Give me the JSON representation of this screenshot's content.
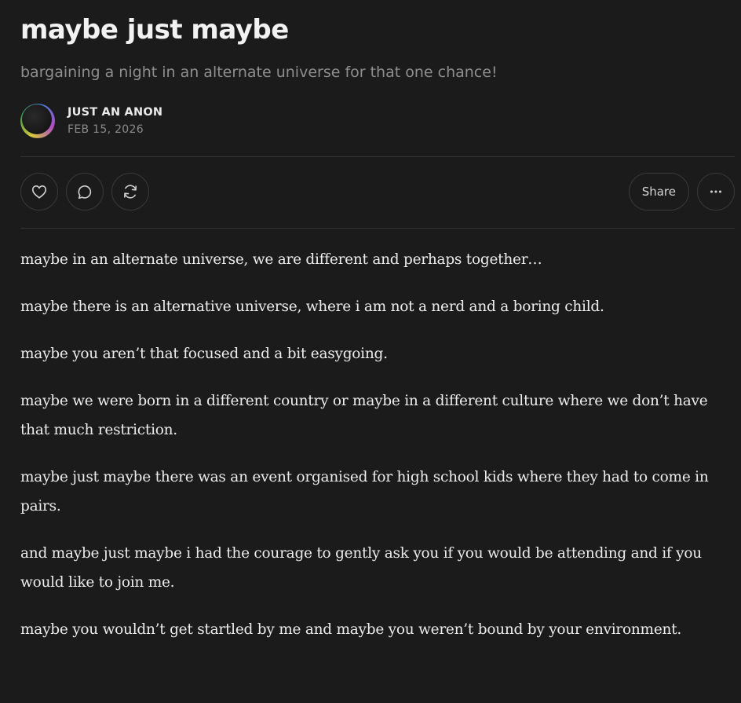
{
  "post": {
    "title": "maybe just maybe",
    "subtitle": "bargaining a night in an alternate universe for that one chance!",
    "author": "JUST AN ANON",
    "date": "FEB 15, 2026"
  },
  "actions": {
    "like_icon": "heart-icon",
    "comment_icon": "comment-icon",
    "restack_icon": "restack-icon",
    "share_label": "Share",
    "more_icon": "more-icon"
  },
  "body": {
    "paragraphs": [
      "maybe in an alternate universe, we are different and perhaps together…",
      "maybe there is an alternative universe, where i am not a nerd and a boring child.",
      "maybe you aren’t that focused and a bit easygoing.",
      "maybe we were born in a different country or maybe in a different culture where we don’t have that much restriction.",
      "maybe just maybe there was an event organised for high school kids where they had to come in pairs.",
      "and maybe just maybe i had the courage to gently ask you if you would be attending and if you would like to join me.",
      "maybe you wouldn’t get startled by me and maybe you weren’t bound by your environment."
    ]
  },
  "colors": {
    "background": "#1b1b1b",
    "text": "#ececec",
    "muted": "#8e8e8e",
    "border": "#3a3a3a"
  }
}
